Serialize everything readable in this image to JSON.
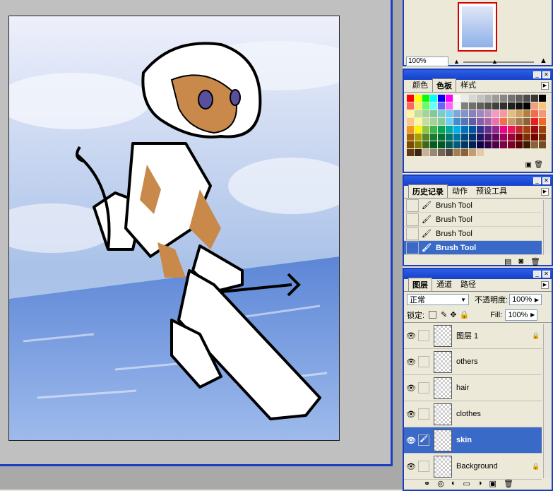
{
  "navigator": {
    "zoom": "100%"
  },
  "swatches_panel": {
    "tabs": [
      "颜色",
      "色板",
      "样式"
    ],
    "active_tab": "色板",
    "colors": [
      "#ff0000",
      "#ffff00",
      "#00ff00",
      "#00ffff",
      "#0000ff",
      "#ff00ff",
      "#ffffff",
      "#ebebeb",
      "#d7d7d7",
      "#c3c3c3",
      "#afafaf",
      "#9b9b9b",
      "#878787",
      "#737373",
      "#5f5f5f",
      "#4b4b4b",
      "#373737",
      "#000000",
      "#ff6464",
      "#fff064",
      "#64ff64",
      "#64ffff",
      "#6464ff",
      "#ff64ff",
      "#f5f5f5",
      "#808080",
      "#707070",
      "#606060",
      "#505050",
      "#404040",
      "#303030",
      "#202020",
      "#101010",
      "#000000",
      "#f4a07a",
      "#f7c47b",
      "#fff799",
      "#c4df9b",
      "#a3d39c",
      "#82ca9c",
      "#7accc8",
      "#6dcff6",
      "#7da7d9",
      "#8393ca",
      "#8781bd",
      "#a186be",
      "#bd8cbf",
      "#f49ac1",
      "#f6989d",
      "#e0c080",
      "#d0a060",
      "#b08040",
      "#f26d4f",
      "#f69679",
      "#fdc68a",
      "#fff79a",
      "#c4df9b",
      "#a3d39c",
      "#82ca9c",
      "#6ecff6",
      "#448ccb",
      "#5574b9",
      "#605ca8",
      "#8560a8",
      "#a864a8",
      "#f06ea9",
      "#f26c4f",
      "#c69c6d",
      "#a67c52",
      "#8c6239",
      "#ed1c24",
      "#f26522",
      "#f7941d",
      "#fff200",
      "#8dc63f",
      "#39b54a",
      "#00a651",
      "#00a99d",
      "#00aeef",
      "#0072bc",
      "#0054a6",
      "#2e3192",
      "#662d91",
      "#92278f",
      "#ec008c",
      "#ed145b",
      "#c1272d",
      "#a0410d",
      "#9e0b0f",
      "#a0410d",
      "#a3620a",
      "#aba000",
      "#598527",
      "#197b30",
      "#007236",
      "#00746b",
      "#0076a3",
      "#004a80",
      "#003471",
      "#1b1464",
      "#440e62",
      "#630460",
      "#9e005d",
      "#9e0039",
      "#790000",
      "#7b2e00",
      "#790000",
      "#7b2e00",
      "#7d4900",
      "#827b00",
      "#406618",
      "#005e20",
      "#005826",
      "#005952",
      "#005b7f",
      "#003663",
      "#002157",
      "#0d004c",
      "#32004b",
      "#4b0049",
      "#7b0046",
      "#7a0026",
      "#5a0000",
      "#3c1a00",
      "#8c6239",
      "#754c24",
      "#603913",
      "#3c2415",
      "#c7b299",
      "#998675",
      "#736357",
      "#534741",
      "#a67c52",
      "#8c6239",
      "#c69c6d",
      "#e6c9a8"
    ]
  },
  "history_panel": {
    "tabs": [
      "历史记录",
      "动作",
      "预设工具"
    ],
    "active_tab": "历史记录",
    "items": [
      {
        "label": "Brush Tool",
        "selected": false
      },
      {
        "label": "Brush Tool",
        "selected": false
      },
      {
        "label": "Brush Tool",
        "selected": false
      },
      {
        "label": "Brush Tool",
        "selected": true
      }
    ]
  },
  "layers_panel": {
    "tabs": [
      "图层",
      "通道",
      "路径"
    ],
    "active_tab": "图层",
    "blend_mode": "正常",
    "opacity_label": "不透明度:",
    "opacity": "100%",
    "lock_label": "锁定:",
    "fill_label": "Fill:",
    "fill": "100%",
    "layers": [
      {
        "name": "图层 1",
        "selected": false,
        "locked": true,
        "brush": false
      },
      {
        "name": "others",
        "selected": false,
        "locked": false,
        "brush": false
      },
      {
        "name": "hair",
        "selected": false,
        "locked": false,
        "brush": false
      },
      {
        "name": "clothes",
        "selected": false,
        "locked": false,
        "brush": false
      },
      {
        "name": "skin",
        "selected": true,
        "locked": false,
        "brush": true
      },
      {
        "name": "Background",
        "selected": false,
        "locked": true,
        "brush": false
      }
    ]
  }
}
